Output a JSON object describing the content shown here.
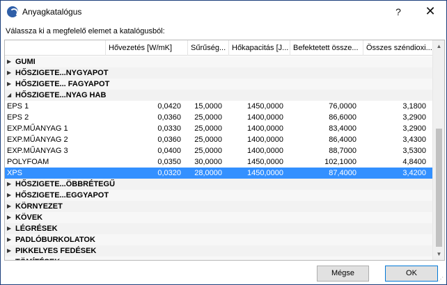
{
  "window": {
    "title": "Anyagkatalógus",
    "help_label": "?",
    "close_label": "✕"
  },
  "instruction": "Válassza ki a megfelelő elemet a katalógusból:",
  "columns": [
    "",
    "Hővezetés [W/mK]",
    "Sűrűség...",
    "Hőkapacitás [J...",
    "Befektetett össze...",
    "Összes széndioxi..."
  ],
  "groups_top": [
    {
      "label": "GUMI",
      "expanded": false
    },
    {
      "label": "HŐSZIGETE...NYGYAPOT",
      "expanded": false
    },
    {
      "label": "HŐSZIGETE... FAGYAPOT",
      "expanded": false
    },
    {
      "label": "HŐSZIGETE...NYAG HAB",
      "expanded": true
    }
  ],
  "items": [
    {
      "name": "EPS 1",
      "c1": "0,0420",
      "c2": "15,0000",
      "c3": "1450,0000",
      "c4": "76,0000",
      "c5": "3,1800",
      "selected": false
    },
    {
      "name": "EPS 2",
      "c1": "0,0360",
      "c2": "25,0000",
      "c3": "1400,0000",
      "c4": "86,6000",
      "c5": "3,2900",
      "selected": false
    },
    {
      "name": "EXP.MŰANYAG 1",
      "c1": "0,0330",
      "c2": "25,0000",
      "c3": "1400,0000",
      "c4": "83,4000",
      "c5": "3,2900",
      "selected": false
    },
    {
      "name": "EXP.MŰANYAG 2",
      "c1": "0,0360",
      "c2": "25,0000",
      "c3": "1400,0000",
      "c4": "86,4000",
      "c5": "3,4300",
      "selected": false
    },
    {
      "name": "EXP.MŰANYAG 3",
      "c1": "0,0400",
      "c2": "25,0000",
      "c3": "1400,0000",
      "c4": "88,7000",
      "c5": "3,5300",
      "selected": false
    },
    {
      "name": "POLYFOAM",
      "c1": "0,0350",
      "c2": "30,0000",
      "c3": "1450,0000",
      "c4": "102,1000",
      "c5": "4,8400",
      "selected": false
    },
    {
      "name": "XPS",
      "c1": "0,0320",
      "c2": "28,0000",
      "c3": "1450,0000",
      "c4": "87,4000",
      "c5": "3,4200",
      "selected": true
    }
  ],
  "groups_bottom": [
    {
      "label": "HŐSZIGETE...ÖBBRÉTEGŰ",
      "expanded": false
    },
    {
      "label": "HŐSZIGETE...EGGYAPOT",
      "expanded": false
    },
    {
      "label": "KÖRNYEZET",
      "expanded": false
    },
    {
      "label": "KÖVEK",
      "expanded": false
    },
    {
      "label": "LÉGRÉSEK",
      "expanded": false
    },
    {
      "label": "PADLÓBURKOLATOK",
      "expanded": false
    },
    {
      "label": "PIKKELYES FEDÉSEK",
      "expanded": false
    },
    {
      "label": "TÖMÍTÉSEK",
      "expanded": false
    }
  ],
  "buttons": {
    "cancel": "Mégse",
    "ok": "OK"
  },
  "colors": {
    "selection": "#3390ff",
    "accent": "#0078d7",
    "group_row": "#f2f2f2"
  }
}
